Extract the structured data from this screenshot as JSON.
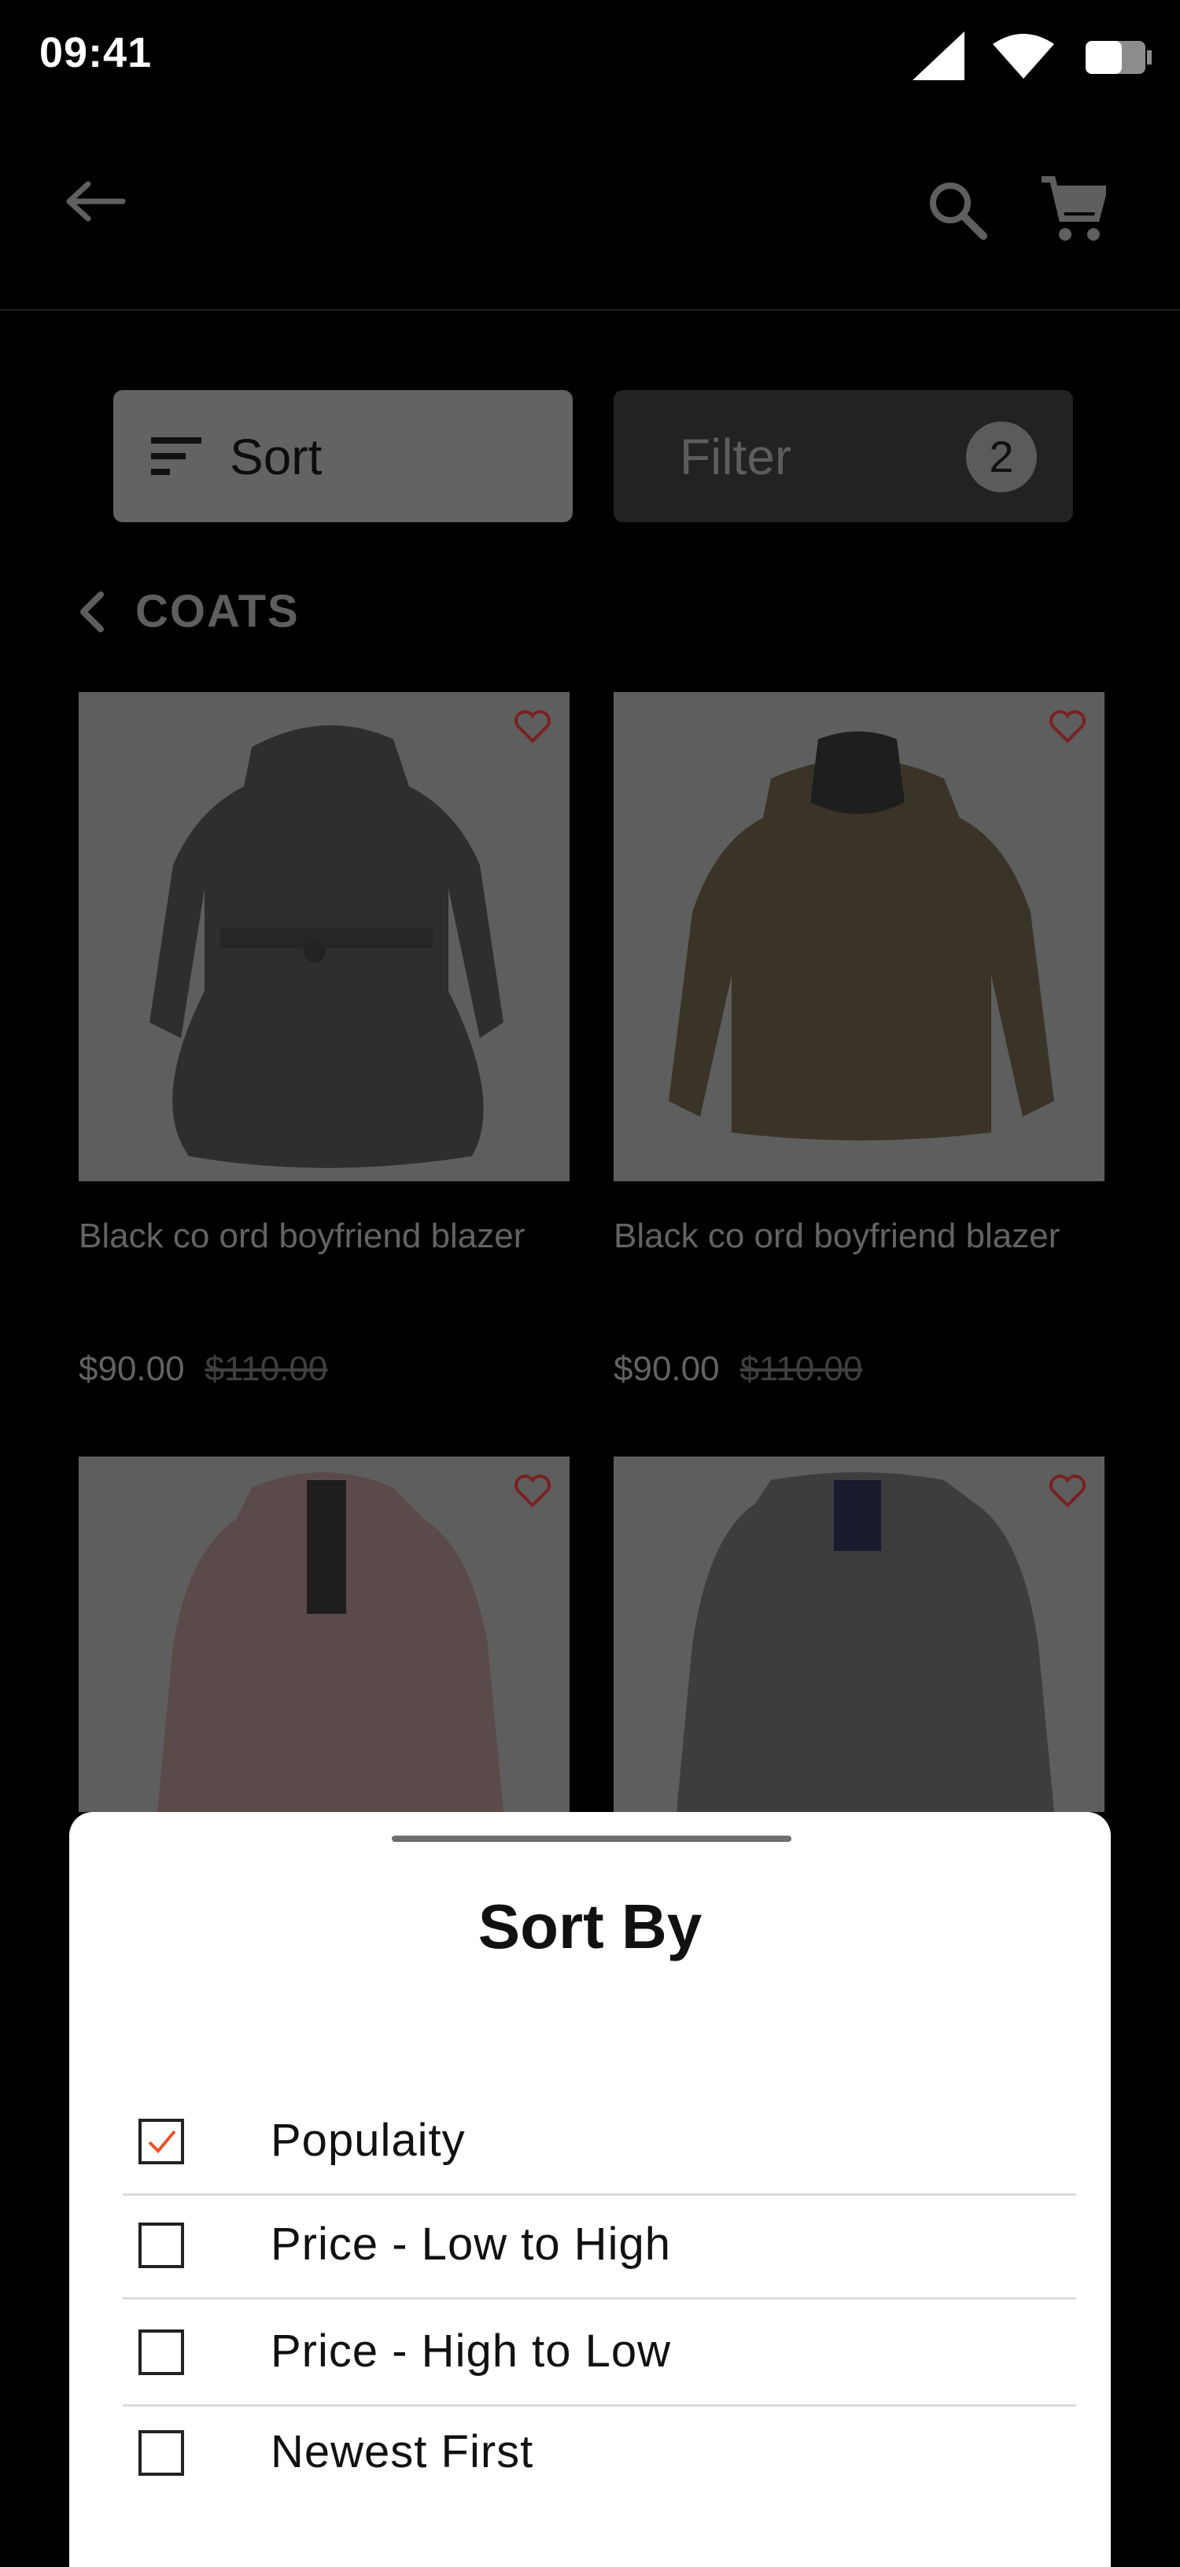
{
  "status": {
    "time": "09:41"
  },
  "toolbar": {
    "back": "arrow-left-icon",
    "search": "search-icon",
    "cart": "cart-icon"
  },
  "actions": {
    "sort_label": "Sort",
    "filter_label": "Filter",
    "filter_count": "2"
  },
  "category": {
    "title": "COATS"
  },
  "products": [
    {
      "name": "Black co ord  boyfriend blazer",
      "price": "$90.00",
      "old_price": "$110.00"
    },
    {
      "name": "Black co ord  boyfriend blazer",
      "price": "$90.00",
      "old_price": "$110.00"
    },
    {
      "name": "",
      "price": "",
      "old_price": ""
    },
    {
      "name": "",
      "price": "",
      "old_price": ""
    }
  ],
  "sort_sheet": {
    "title": "Sort By",
    "options": [
      {
        "label": "Populaity",
        "checked": true
      },
      {
        "label": "Price - Low to High",
        "checked": false
      },
      {
        "label": "Price - High to Low",
        "checked": false
      },
      {
        "label": "Newest First",
        "checked": false
      }
    ]
  },
  "colors": {
    "accent": "#e8532a",
    "overlay": "#000000",
    "sheet": "#ffffff"
  }
}
